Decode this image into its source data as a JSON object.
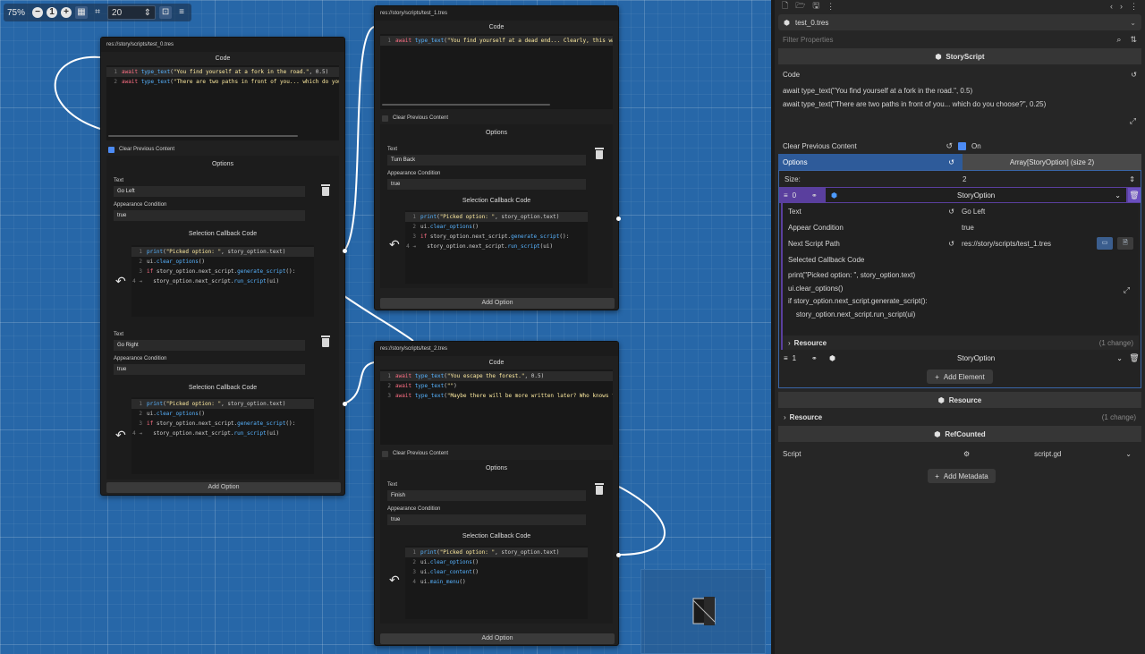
{
  "toolbar": {
    "zoom": "75%",
    "snap_value": "20"
  },
  "nodes": [
    {
      "path": "res://story/scripts/test_0.tres",
      "code_title": "Code",
      "code": [
        {
          "n": "1",
          "parts": [
            [
              "kw",
              "await "
            ],
            [
              "fn",
              "type_text"
            ],
            [
              "pl",
              "("
            ],
            [
              "st",
              "\"You find yourself at a fork in the road.\""
            ],
            [
              "pl",
              ", 0.5)"
            ]
          ]
        },
        {
          "n": "2",
          "parts": [
            [
              "kw",
              "await "
            ],
            [
              "fn",
              "type_text"
            ],
            [
              "pl",
              "("
            ],
            [
              "st",
              "\"There are two paths in front of you... which do you"
            ]
          ]
        }
      ],
      "clear_label": "Clear Previous Content",
      "clear_on": true,
      "options_title": "Options",
      "options": [
        {
          "text_label": "Text",
          "text": "Go Left",
          "cond_label": "Appearance Condition",
          "cond": "true",
          "cb_title": "Selection Callback Code",
          "cb": [
            {
              "n": "1",
              "parts": [
                [
                  "fn",
                  "print"
                ],
                [
                  "pl",
                  "("
                ],
                [
                  "st",
                  "\"Picked option: \""
                ],
                [
                  "pl",
                  ", story_option.text)"
                ]
              ]
            },
            {
              "n": "2",
              "parts": [
                [
                  "pl",
                  "ui."
                ],
                [
                  "fn",
                  "clear_options"
                ],
                [
                  "pl",
                  "()"
                ]
              ]
            },
            {
              "n": "3",
              "parts": [
                [
                  "kw",
                  "if "
                ],
                [
                  "pl",
                  "story_option.next_script."
                ],
                [
                  "fn",
                  "generate_script"
                ],
                [
                  "pl",
                  "():"
                ]
              ]
            },
            {
              "n": "4 ⇥",
              "parts": [
                [
                  "pl",
                  "  story_option.next_script."
                ],
                [
                  "fn",
                  "run_script"
                ],
                [
                  "pl",
                  "(ui)"
                ]
              ]
            }
          ]
        },
        {
          "text_label": "Text",
          "text": "Go Right",
          "cond_label": "Appearance Condition",
          "cond": "true",
          "cb_title": "Selection Callback Code",
          "cb": [
            {
              "n": "1",
              "parts": [
                [
                  "fn",
                  "print"
                ],
                [
                  "pl",
                  "("
                ],
                [
                  "st",
                  "\"Picked option: \""
                ],
                [
                  "pl",
                  ", story_option.text)"
                ]
              ]
            },
            {
              "n": "2",
              "parts": [
                [
                  "pl",
                  "ui."
                ],
                [
                  "fn",
                  "clear_options"
                ],
                [
                  "pl",
                  "()"
                ]
              ]
            },
            {
              "n": "3",
              "parts": [
                [
                  "kw",
                  "if "
                ],
                [
                  "pl",
                  "story_option.next_script."
                ],
                [
                  "fn",
                  "generate_script"
                ],
                [
                  "pl",
                  "():"
                ]
              ]
            },
            {
              "n": "4 ⇥",
              "parts": [
                [
                  "pl",
                  "  story_option.next_script."
                ],
                [
                  "fn",
                  "run_script"
                ],
                [
                  "pl",
                  "(ui)"
                ]
              ]
            }
          ]
        }
      ],
      "add_option": "Add Option"
    },
    {
      "path": "res://story/scripts/test_1.tres",
      "code_title": "Code",
      "code": [
        {
          "n": "1",
          "parts": [
            [
              "kw",
              "await "
            ],
            [
              "fn",
              "type_text"
            ],
            [
              "pl",
              "("
            ],
            [
              "st",
              "\"You find yourself at a dead end... Clearly, this was"
            ]
          ]
        }
      ],
      "clear_label": "Clear Previous Content",
      "clear_on": false,
      "options_title": "Options",
      "options": [
        {
          "text_label": "Text",
          "text": "Turn Back",
          "cond_label": "Appearance Condition",
          "cond": "true",
          "cb_title": "Selection Callback Code",
          "cb": [
            {
              "n": "1",
              "parts": [
                [
                  "fn",
                  "print"
                ],
                [
                  "pl",
                  "("
                ],
                [
                  "st",
                  "\"Picked option: \""
                ],
                [
                  "pl",
                  ", story_option.text)"
                ]
              ]
            },
            {
              "n": "2",
              "parts": [
                [
                  "pl",
                  "ui."
                ],
                [
                  "fn",
                  "clear_options"
                ],
                [
                  "pl",
                  "()"
                ]
              ]
            },
            {
              "n": "3",
              "parts": [
                [
                  "kw",
                  "if "
                ],
                [
                  "pl",
                  "story_option.next_script."
                ],
                [
                  "fn",
                  "generate_script"
                ],
                [
                  "pl",
                  "():"
                ]
              ]
            },
            {
              "n": "4 ⇥",
              "parts": [
                [
                  "pl",
                  "  story_option.next_script."
                ],
                [
                  "fn",
                  "run_script"
                ],
                [
                  "pl",
                  "(ui)"
                ]
              ]
            }
          ]
        }
      ],
      "add_option": "Add Option"
    },
    {
      "path": "res://story/scripts/test_2.tres",
      "code_title": "Code",
      "code": [
        {
          "n": "1",
          "parts": [
            [
              "kw",
              "await "
            ],
            [
              "fn",
              "type_text"
            ],
            [
              "pl",
              "("
            ],
            [
              "st",
              "\"You escape the forest.\""
            ],
            [
              "pl",
              ", 0.5)"
            ]
          ]
        },
        {
          "n": "2",
          "parts": [
            [
              "kw",
              "await "
            ],
            [
              "fn",
              "type_text"
            ],
            [
              "pl",
              "("
            ],
            [
              "st",
              "\"\""
            ],
            [
              "pl",
              ")"
            ]
          ]
        },
        {
          "n": "3",
          "parts": [
            [
              "kw",
              "await "
            ],
            [
              "fn",
              "type_text"
            ],
            [
              "pl",
              "("
            ],
            [
              "st",
              "\"Maybe there will be more written later? Who knows fo"
            ]
          ]
        }
      ],
      "clear_label": "Clear Previous Content",
      "clear_on": false,
      "options_title": "Options",
      "options": [
        {
          "text_label": "Text",
          "text": "Finish",
          "cond_label": "Appearance Condition",
          "cond": "true",
          "cb_title": "Selection Callback Code",
          "cb": [
            {
              "n": "1",
              "parts": [
                [
                  "fn",
                  "print"
                ],
                [
                  "pl",
                  "("
                ],
                [
                  "st",
                  "\"Picked option: \""
                ],
                [
                  "pl",
                  ", story_option.text)"
                ]
              ]
            },
            {
              "n": "2",
              "parts": [
                [
                  "pl",
                  "ui."
                ],
                [
                  "fn",
                  "clear_options"
                ],
                [
                  "pl",
                  "()"
                ]
              ]
            },
            {
              "n": "3",
              "parts": [
                [
                  "pl",
                  "ui."
                ],
                [
                  "fn",
                  "clear_content"
                ],
                [
                  "pl",
                  "()"
                ]
              ]
            },
            {
              "n": "4",
              "parts": [
                [
                  "pl",
                  "ui."
                ],
                [
                  "fn",
                  "main_menu"
                ],
                [
                  "pl",
                  "()"
                ]
              ]
            }
          ]
        }
      ],
      "add_option": "Add Option"
    }
  ],
  "inspector": {
    "resource_name": "test_0.tres",
    "filter_placeholder": "Filter Properties",
    "storyscript_header": "StoryScript",
    "code_label": "Code",
    "code_lines": [
      "await type_text(\"You find yourself at a fork in the road.\", 0.5)",
      "await type_text(\"There are two paths in front of you... which do you choose?\", 0.25)"
    ],
    "clear_label": "Clear Previous Content",
    "clear_value": "On",
    "options_label": "Options",
    "options_value": "Array[StoryOption] (size 2)",
    "size_label": "Size:",
    "size_value": "2",
    "elements": [
      {
        "index": "0",
        "type": "StoryOption",
        "text_label": "Text",
        "text_value": "Go Left",
        "cond_label": "Appear Condition",
        "cond_value": "true",
        "path_label": "Next Script Path",
        "path_value": "res://story/scripts/test_1.tres",
        "cb_label": "Selected Callback Code",
        "cb_lines": [
          "print(\"Picked option: \", story_option.text)",
          "ui.clear_options()",
          "if story_option.next_script.generate_script():",
          "    story_option.next_script.run_script(ui)"
        ],
        "resource_label": "Resource",
        "resource_changes": "(1 change)"
      },
      {
        "index": "1",
        "type": "StoryOption"
      }
    ],
    "add_element": "Add Element",
    "resource_header": "Resource",
    "resource_fold_label": "Resource",
    "resource_fold_changes": "(1 change)",
    "refcounted_header": "RefCounted",
    "script_label": "Script",
    "script_value": "script.gd",
    "add_metadata": "Add Metadata"
  }
}
